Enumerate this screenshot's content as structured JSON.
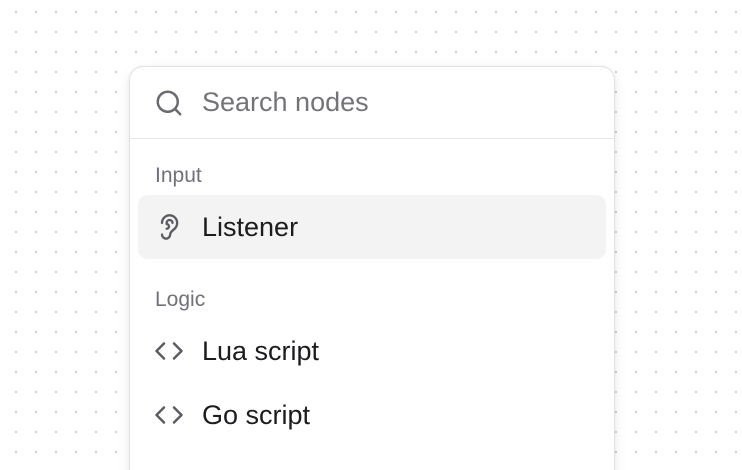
{
  "search": {
    "placeholder": "Search nodes",
    "icon": "search-icon"
  },
  "groups": [
    {
      "label": "Input",
      "items": [
        {
          "label": "Listener",
          "icon": "ear-icon",
          "highlighted": true
        }
      ]
    },
    {
      "label": "Logic",
      "items": [
        {
          "label": "Lua script",
          "icon": "code-icon",
          "highlighted": false
        },
        {
          "label": "Go script",
          "icon": "code-icon",
          "highlighted": false
        }
      ]
    }
  ],
  "colors": {
    "highlight_bg": "#f3f3f3",
    "group_label": "#71717a",
    "text": "#1c1c1f",
    "border": "#e2e2e2"
  }
}
